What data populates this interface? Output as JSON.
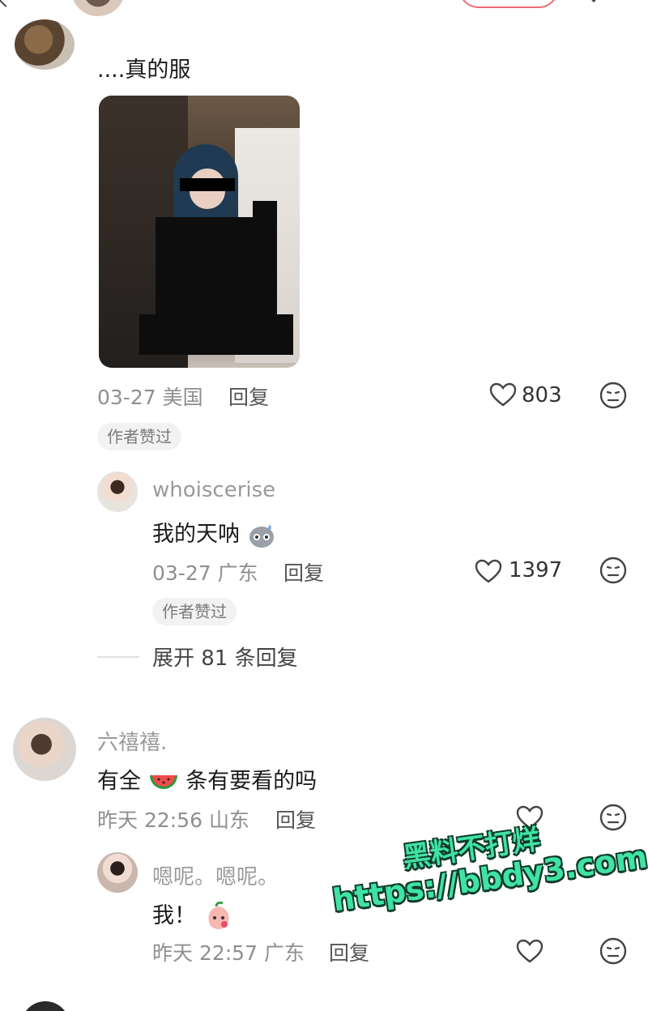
{
  "header": {},
  "comments": [
    {
      "username": "",
      "text": "....真的服",
      "date": "03-27",
      "location": "美国",
      "reply_label": "回复",
      "likes": "803",
      "badge": "作者赞过"
    },
    {
      "username": "whoiscerise",
      "text": "我的天呐",
      "date": "03-27",
      "location": "广东",
      "reply_label": "回复",
      "likes": "1397",
      "badge": "作者赞过"
    },
    {
      "username": "六禧禧.",
      "text_before": "有全",
      "text_after": "条有要看的吗",
      "date": "昨天 22:56",
      "location": "山东",
      "reply_label": "回复"
    },
    {
      "username": "嗯呢。嗯呢。",
      "text": "我！",
      "date": "昨天 22:57",
      "location": "广东",
      "reply_label": "回复"
    }
  ],
  "expand_replies": "展开 81 条回复",
  "watermark": {
    "line1": "黑料不打烊",
    "line2": "https://bbdy3.com"
  },
  "icons": {
    "like": "heart-outline-icon",
    "dislike": "sad-face-icon"
  },
  "colors": {
    "watermark": "#3fe3a4",
    "follow_border": "#ef6b76"
  }
}
